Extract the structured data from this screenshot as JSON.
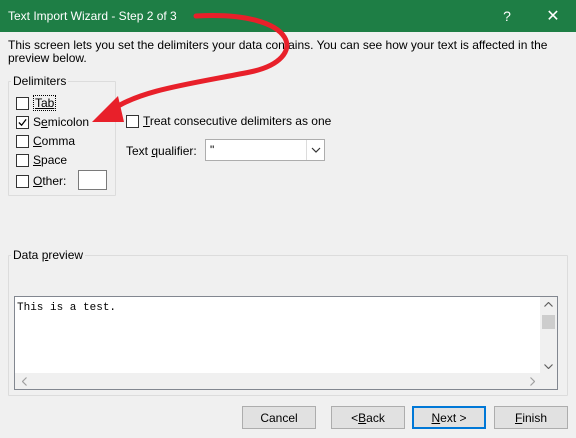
{
  "window": {
    "title": "Text Import Wizard - Step 2 of 3",
    "help_glyph": "?",
    "close_glyph": "✕",
    "accent": "#1e7e45"
  },
  "intro": "This screen lets you set the delimiters your data contains.  You can see how your text is affected in the preview below.",
  "delimiters": {
    "legend": "Delimiters",
    "tab": {
      "label": "Tab",
      "checked": false
    },
    "semicolon": {
      "label_pre": "S",
      "label_u": "e",
      "label_post": "micolon",
      "checked": true
    },
    "comma": {
      "label_u": "C",
      "label_post": "omma",
      "checked": false
    },
    "space": {
      "label_u": "S",
      "label_post": "pace",
      "checked": false
    },
    "other": {
      "label_u": "O",
      "label_post": "ther:",
      "checked": false,
      "value": ""
    }
  },
  "treat_consecutive": {
    "label_u": "T",
    "label_post": "reat consecutive delimiters as one",
    "checked": false
  },
  "text_qualifier": {
    "label_pre": "Text ",
    "label_u": "q",
    "label_post": "ualifier:",
    "value": "\""
  },
  "preview": {
    "legend_pre": "Data ",
    "legend_u": "p",
    "legend_post": "review",
    "text": "This is a test."
  },
  "buttons": {
    "cancel": "Cancel",
    "back_pre": "< ",
    "back_u": "B",
    "back_post": "ack",
    "next_u": "N",
    "next_post": "ext >",
    "finish_u": "F",
    "finish_post": "inish"
  },
  "annotation": {
    "color": "#e8202a"
  }
}
